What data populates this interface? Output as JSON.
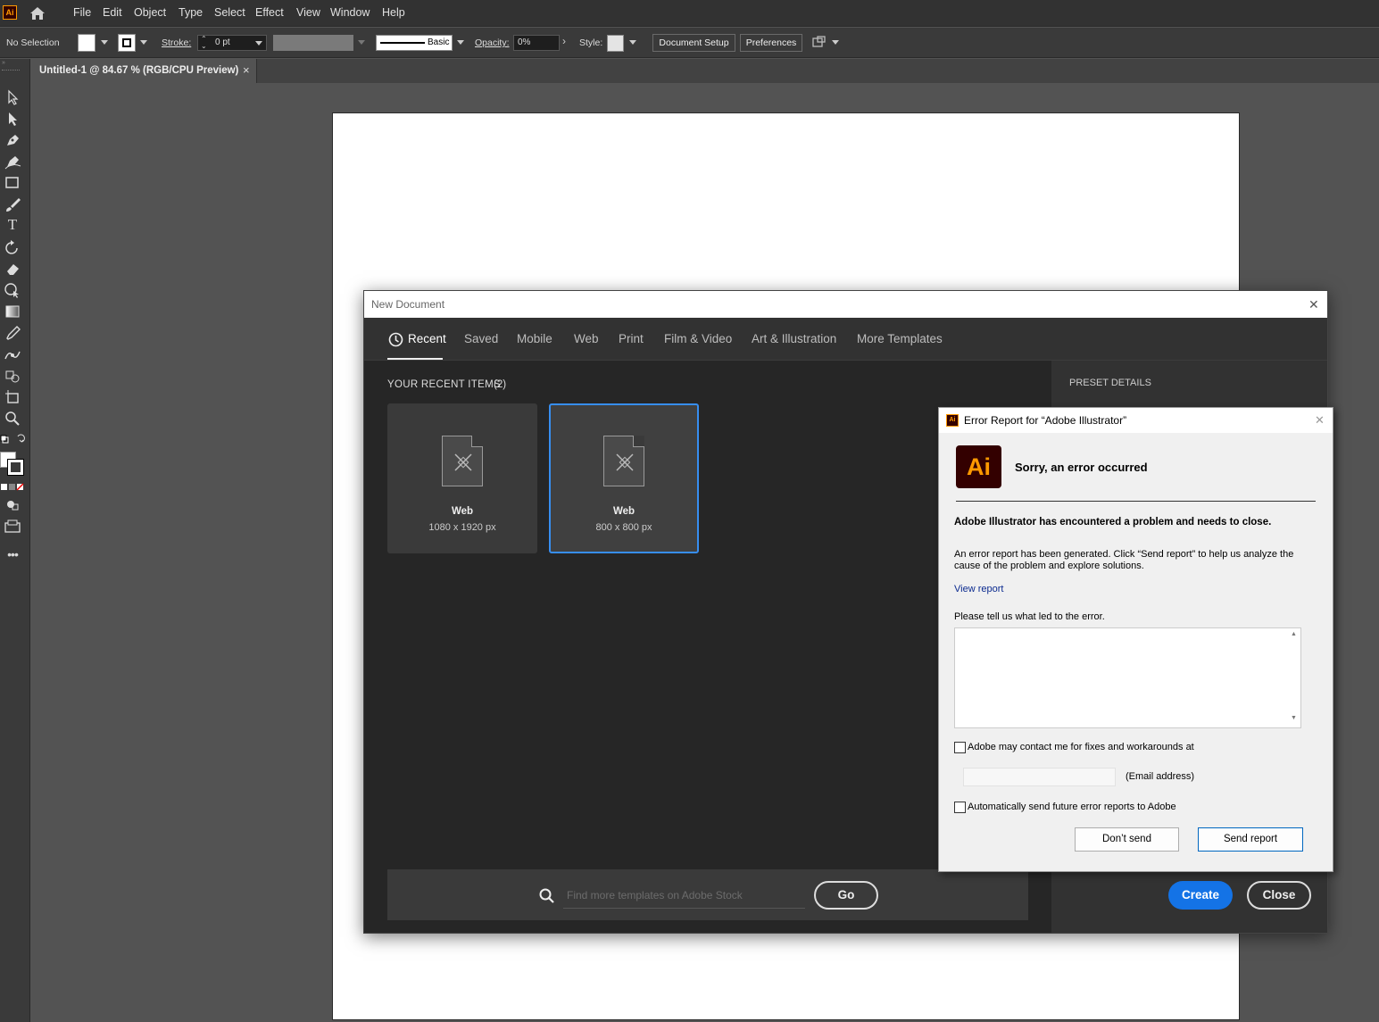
{
  "menubar": {
    "logo": "Ai",
    "items": [
      "File",
      "Edit",
      "Object",
      "Type",
      "Select",
      "Effect",
      "View",
      "Window",
      "Help"
    ]
  },
  "controlbar": {
    "selection": "No Selection",
    "stroke_label": "Stroke:",
    "stroke_value": "0 pt",
    "brush_label": "Basic",
    "opacity_label": "Opacity:",
    "opacity_value": "0%",
    "style_label": "Style:",
    "document_setup": "Document Setup",
    "preferences": "Preferences"
  },
  "tabbar": {
    "doc_tab": "Untitled-1 @ 84.67 % (RGB/CPU Preview)",
    "close_glyph": "×"
  },
  "new_document": {
    "title": "New Document",
    "close_glyph": "✕",
    "tabs": [
      "Recent",
      "Saved",
      "Mobile",
      "Web",
      "Print",
      "Film & Video",
      "Art & Illustration",
      "More Templates"
    ],
    "active_tab": "Recent",
    "recent_heading": "YOUR RECENT ITEMS",
    "recent_count": "(2)",
    "items": [
      {
        "name": "Web",
        "size": "1080 x 1920 px"
      },
      {
        "name": "Web",
        "size": "800 x 800 px"
      }
    ],
    "preset_details": "PRESET DETAILS",
    "search_placeholder": "Find more templates on Adobe Stock",
    "go": "Go",
    "create": "Create",
    "close": "Close"
  },
  "error_report": {
    "title": "Error Report for “Adobe Illustrator”",
    "logo": "Ai",
    "small_logo": "Ai",
    "heading": "Sorry, an error occurred",
    "problem": "Adobe Illustrator has encountered a problem and needs to close.",
    "description": "An error report has been generated. Click “Send report” to help us analyze the cause of the problem and explore solutions.",
    "view_report": "View report",
    "tell_us": "Please tell us what led to the error.",
    "contact_label": "Adobe may contact me for fixes and workarounds at",
    "email_label": "(Email address)",
    "auto_send_label": "Automatically send future error reports to Adobe",
    "dont_send": "Don’t send",
    "send_report": "Send report",
    "close_glyph": "✕"
  },
  "colors": {
    "accent_blue": "#378ef0",
    "create_blue": "#1473e6",
    "ai_orange": "#ff9a00",
    "ai_dark": "#330000"
  }
}
